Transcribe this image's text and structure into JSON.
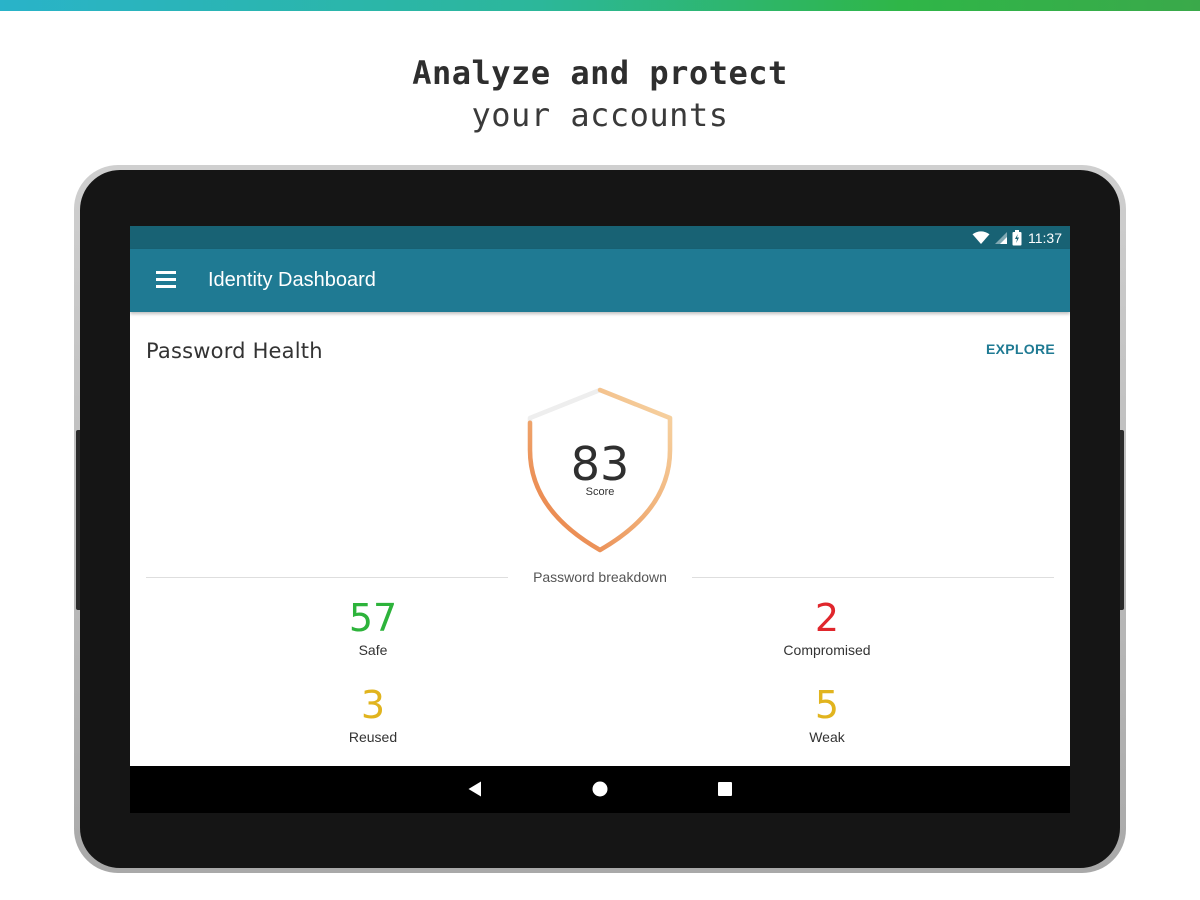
{
  "promo": {
    "line1": "Analyze and protect",
    "line2": "your accounts"
  },
  "status_bar": {
    "time": "11:37",
    "icons": [
      "wifi-icon",
      "cell-signal-icon",
      "battery-charging-icon"
    ]
  },
  "app_bar": {
    "menu_icon": "hamburger-menu-icon",
    "title": "Identity Dashboard"
  },
  "card": {
    "title": "Password Health",
    "action_label": "EXPLORE",
    "score": {
      "value": "83",
      "label": "Score",
      "fraction": 0.83
    },
    "breakdown_label": "Password breakdown",
    "stats": [
      {
        "value": "57",
        "label": "Safe",
        "color": "#2db33b"
      },
      {
        "value": "2",
        "label": "Compromised",
        "color": "#e0262c"
      },
      {
        "value": "3",
        "label": "Reused",
        "color": "#e1b41e"
      },
      {
        "value": "5",
        "label": "Weak",
        "color": "#e1b41e"
      }
    ]
  },
  "nav_bar": {
    "icons": [
      "back-icon",
      "home-icon",
      "recents-icon"
    ]
  },
  "colors": {
    "status_bar": "#186274",
    "app_bar": "#1f7a93",
    "accent": "#1f7a93",
    "shield_start": "#e8783e",
    "shield_end": "#f7d6a6"
  }
}
